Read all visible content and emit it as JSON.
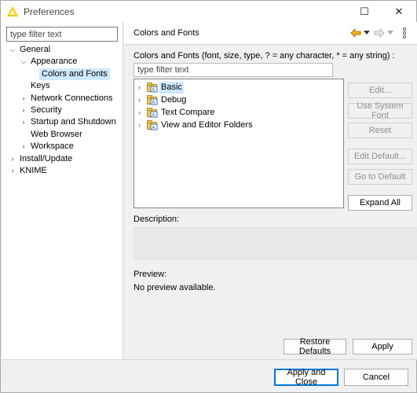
{
  "window": {
    "title": "Preferences",
    "maximize_glyph": "☐",
    "close_glyph": "✕"
  },
  "left": {
    "filter_placeholder": "type filter text",
    "tree": [
      {
        "label": "General",
        "level": 0,
        "twisty": "expanded",
        "selected": false
      },
      {
        "label": "Appearance",
        "level": 1,
        "twisty": "expanded",
        "selected": false
      },
      {
        "label": "Colors and Fonts",
        "level": 2,
        "twisty": "none",
        "selected": true
      },
      {
        "label": "Keys",
        "level": 1,
        "twisty": "none",
        "selected": false
      },
      {
        "label": "Network Connections",
        "level": 1,
        "twisty": "collapsed",
        "selected": false
      },
      {
        "label": "Security",
        "level": 1,
        "twisty": "collapsed",
        "selected": false
      },
      {
        "label": "Startup and Shutdown",
        "level": 1,
        "twisty": "collapsed",
        "selected": false
      },
      {
        "label": "Web Browser",
        "level": 1,
        "twisty": "none",
        "selected": false
      },
      {
        "label": "Workspace",
        "level": 1,
        "twisty": "collapsed",
        "selected": false
      },
      {
        "label": "Install/Update",
        "level": 0,
        "twisty": "collapsed",
        "selected": false
      },
      {
        "label": "KNIME",
        "level": 0,
        "twisty": "collapsed",
        "selected": false
      }
    ]
  },
  "page": {
    "title": "Colors and Fonts",
    "description_line": "Colors and Fonts (font, size, type, ? = any character, * = any string) :",
    "filter_placeholder": "type filter text",
    "categories": [
      {
        "label": "Basic",
        "selected": true
      },
      {
        "label": "Debug",
        "selected": false
      },
      {
        "label": "Text Compare",
        "selected": false
      },
      {
        "label": "View and Editor Folders",
        "selected": false
      }
    ],
    "side_buttons": [
      {
        "label": "Edit...",
        "enabled": false
      },
      {
        "label": "Use System Font",
        "enabled": false
      },
      {
        "label": "Reset",
        "enabled": false
      },
      {
        "label": "Edit Default...",
        "enabled": false
      },
      {
        "label": "Go to Default",
        "enabled": false
      },
      {
        "label": "Expand All",
        "enabled": true
      }
    ],
    "description_label": "Description:",
    "preview_label": "Preview:",
    "preview_text": "No preview available.",
    "restore_defaults": "Restore Defaults",
    "apply": "Apply"
  },
  "footer": {
    "apply_and_close": "Apply and Close",
    "cancel": "Cancel"
  },
  "colors": {
    "selection": "#cde8ff",
    "default_button_border": "#0078d7",
    "nav_arrow": "#d99a0c",
    "app_icon": "#f5c400"
  },
  "icons": [
    "app-icon",
    "back-arrow-icon",
    "forward-arrow-icon",
    "dropdown-icon",
    "view-menu-icon",
    "font-category-icon"
  ]
}
